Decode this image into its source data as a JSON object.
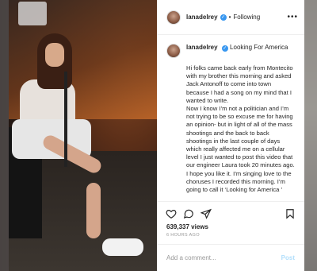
{
  "post": {
    "username": "lanadelrey",
    "following_label": "Following",
    "caption_title": "Looking For America",
    "caption_text": "Hi folks came back early from Montecito with my brother this morning and asked Jack Antonoff to come into town because I had a song on my mind that I wanted to write.\nNow I know I’m not a politician and I’m not trying to be so excuse me for having an opinion- but in light of all of the mass shootings and the back to back shootings in the last couple of days which really affected me on a cellular level I just wanted to post this video that our engineer Laura took 20 minutes ago. I hope you like it. I’m singing love to the choruses I recorded this morning. I’m going to call it ‘Looking for America ’",
    "views": "639,337 views",
    "time": "6 HOURS AGO",
    "comment_placeholder": "Add a comment...",
    "post_label": "Post"
  },
  "icons": {
    "verified": "verified-badge-icon",
    "more": "more-options-icon",
    "like": "heart-icon",
    "comment": "comment-icon",
    "share": "share-icon",
    "save": "bookmark-icon"
  },
  "colors": {
    "verified": "#3897f0",
    "post_button_disabled": "#b2dffc"
  }
}
